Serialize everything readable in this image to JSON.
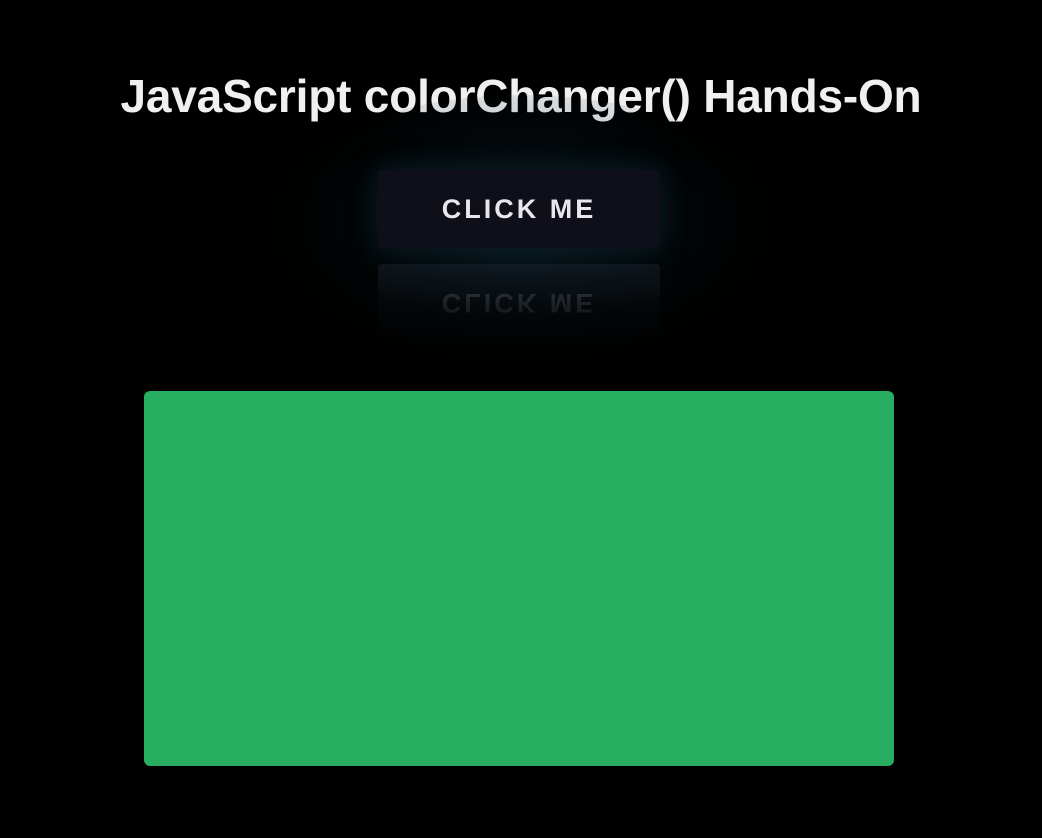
{
  "page": {
    "title": "JavaScript colorChanger() Hands-On"
  },
  "button": {
    "label": "CLICK ME",
    "reflection_label": "CLICK ME"
  },
  "color_box": {
    "color": "#27ae60"
  },
  "colors": {
    "background": "#000000",
    "title_text": "#f0f0f2",
    "button_background": "#0f0f1a",
    "button_text": "#e8e8ec",
    "glow": "#143c4b"
  }
}
